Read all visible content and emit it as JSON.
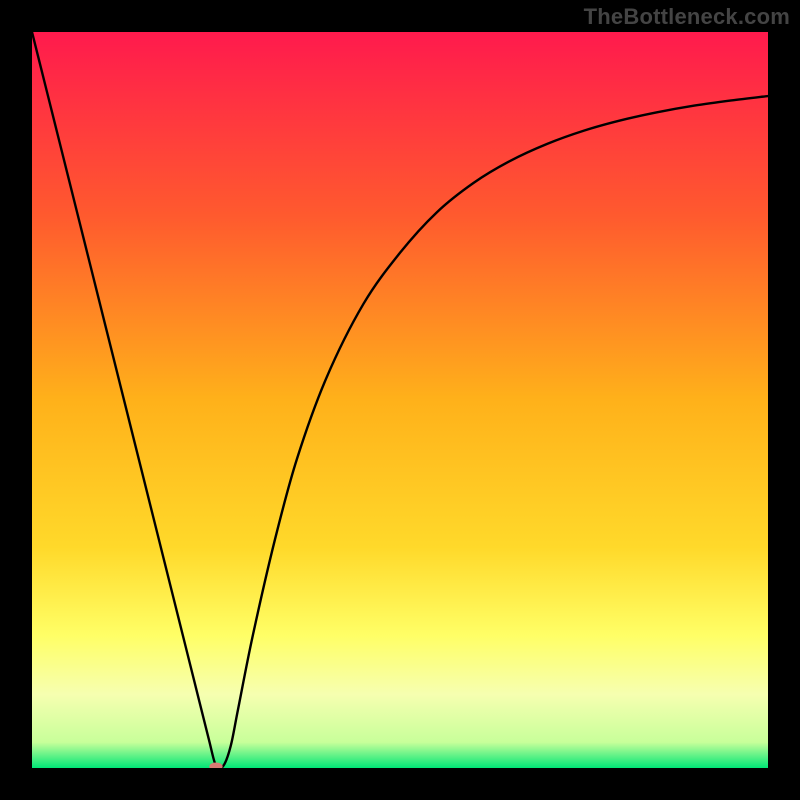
{
  "watermark": "TheBottleneck.com",
  "chart_data": {
    "type": "line",
    "title": "",
    "xlabel": "",
    "ylabel": "",
    "xlim": [
      0,
      100
    ],
    "ylim": [
      0,
      100
    ],
    "grid": false,
    "legend": false,
    "background_gradient_stops": [
      {
        "offset": 0.0,
        "color": "#ff1a4d"
      },
      {
        "offset": 0.25,
        "color": "#ff5a2e"
      },
      {
        "offset": 0.5,
        "color": "#ffb11a"
      },
      {
        "offset": 0.7,
        "color": "#ffd92a"
      },
      {
        "offset": 0.82,
        "color": "#ffff66"
      },
      {
        "offset": 0.9,
        "color": "#f6ffb0"
      },
      {
        "offset": 0.965,
        "color": "#c8ff9a"
      },
      {
        "offset": 1.0,
        "color": "#00e676"
      }
    ],
    "series": [
      {
        "name": "bottleneck-curve",
        "color": "#000000",
        "x": [
          0.0,
          2.0,
          4.0,
          6.0,
          8.0,
          10.0,
          12.0,
          14.0,
          16.0,
          18.0,
          20.0,
          22.0,
          24.0,
          25.0,
          26.0,
          27.0,
          28.0,
          30.0,
          33.0,
          36.0,
          40.0,
          45.0,
          50.0,
          55.0,
          60.0,
          65.0,
          70.0,
          75.0,
          80.0,
          85.0,
          90.0,
          95.0,
          100.0
        ],
        "y": [
          100.0,
          92.0,
          84.0,
          76.0,
          68.0,
          60.0,
          52.0,
          44.0,
          36.0,
          28.0,
          20.0,
          12.0,
          4.0,
          0.3,
          0.3,
          3.0,
          8.0,
          18.0,
          31.0,
          42.0,
          53.0,
          63.0,
          70.0,
          75.5,
          79.5,
          82.5,
          84.8,
          86.6,
          88.0,
          89.1,
          90.0,
          90.7,
          91.3
        ]
      }
    ],
    "marker": {
      "name": "optimal-point",
      "x": 25.0,
      "y": 0.2,
      "rx": 0.9,
      "ry": 0.55,
      "color": "#d87b74"
    }
  }
}
